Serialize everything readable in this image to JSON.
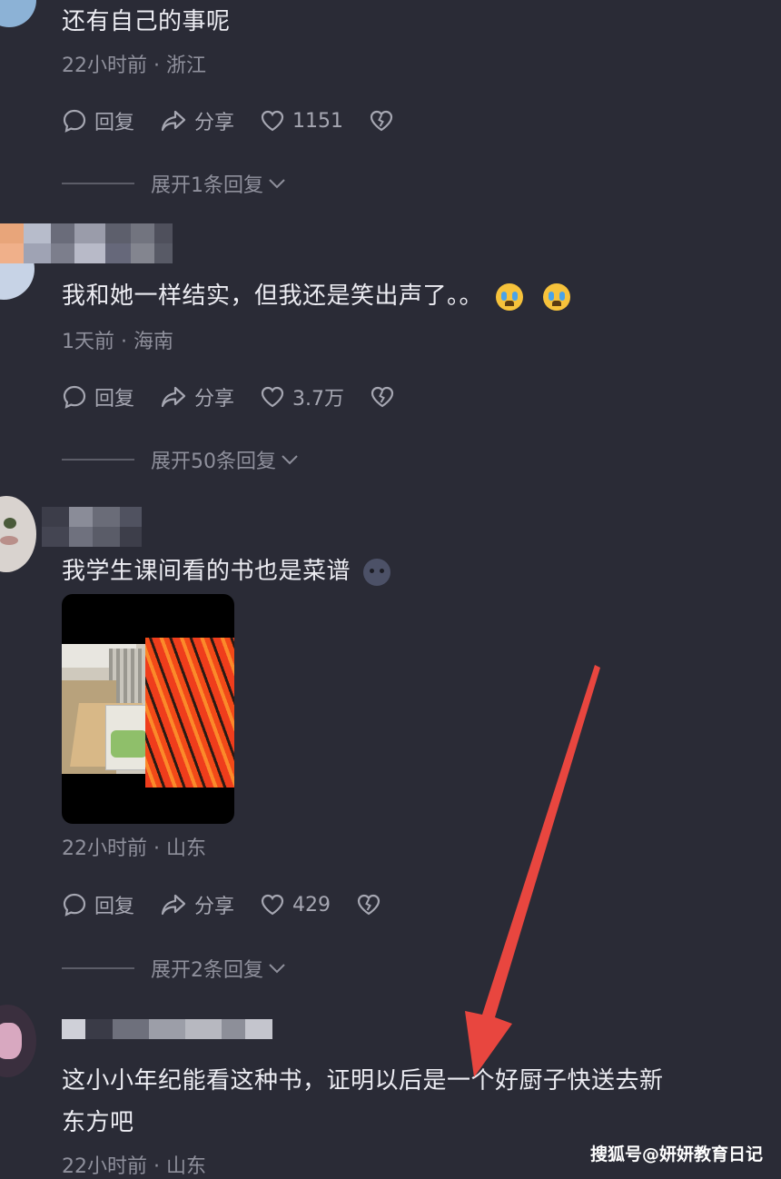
{
  "comments": [
    {
      "text": "还有自己的事呢",
      "meta": "22小时前 · 浙江",
      "actions": {
        "reply": "回复",
        "share": "分享",
        "likes": "1151"
      },
      "expand": "展开1条回复"
    },
    {
      "text": "我和她一样结实，但我还是笑出声了。。",
      "emojis": [
        "crying-face",
        "crying-face"
      ],
      "meta": "1天前 · 海南",
      "actions": {
        "reply": "回复",
        "share": "分享",
        "likes": "3.7万"
      },
      "expand": "展开50条回复"
    },
    {
      "text": "我学生课间看的书也是菜谱",
      "emojis": [
        "gloomy-face"
      ],
      "meta": "22小时前 · 山东",
      "actions": {
        "reply": "回复",
        "share": "分享",
        "likes": "429"
      },
      "expand": "展开2条回复"
    },
    {
      "text_line1": "这小小年纪能看这种书，证明以后是一个好厨子快送去新",
      "text_line2": "东方吧",
      "meta": "22小时前 · 山东"
    }
  ],
  "watermark": "搜狐号@妍妍教育日记",
  "colors": {
    "background": "#2a2b36",
    "arrow": "#e8463f",
    "text": "#ececf2",
    "meta": "#8f909c"
  }
}
